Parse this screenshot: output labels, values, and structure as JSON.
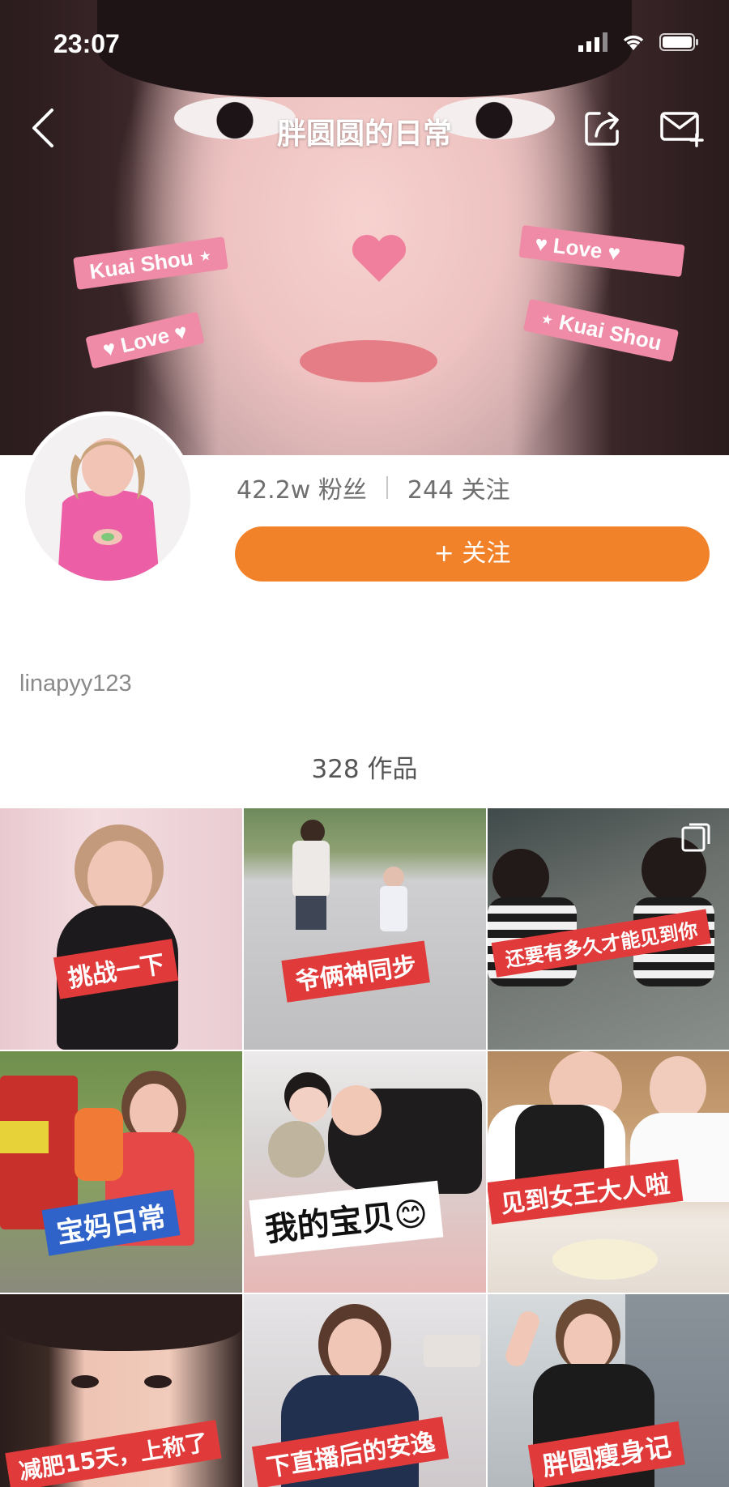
{
  "status_bar": {
    "time": "23:07"
  },
  "nav": {
    "title": "胖圆圆的日常"
  },
  "cover_stickers": [
    "Kuai Shou ⋆",
    "♥ Love ♥",
    "♥ Love ♥",
    "⋆ Kuai Shou"
  ],
  "profile": {
    "followers": "42.2w 粉丝",
    "following": "244 关注",
    "follow_button": "+ 关注",
    "username": "linapyy123",
    "works_count": "328 作品"
  },
  "grid": [
    {
      "caption": "挑战一下"
    },
    {
      "caption": "爷俩神同步"
    },
    {
      "caption": "还要有多久才能见到你"
    },
    {
      "caption": "宝妈日常"
    },
    {
      "caption": "我的宝贝😊"
    },
    {
      "caption": "见到女王大人啦"
    },
    {
      "caption": "减肥15天，上称了"
    },
    {
      "caption": "下直播后的安逸"
    },
    {
      "caption": "胖圆瘦身记"
    }
  ],
  "colors": {
    "accent": "#f2822a",
    "caption_red": "#e03a3a",
    "sticker_pink": "#ef8aa7"
  },
  "icons": [
    "back-icon",
    "share-icon",
    "mail-icon",
    "multi-photo-icon",
    "signal-icon",
    "wifi-icon",
    "battery-icon"
  ]
}
